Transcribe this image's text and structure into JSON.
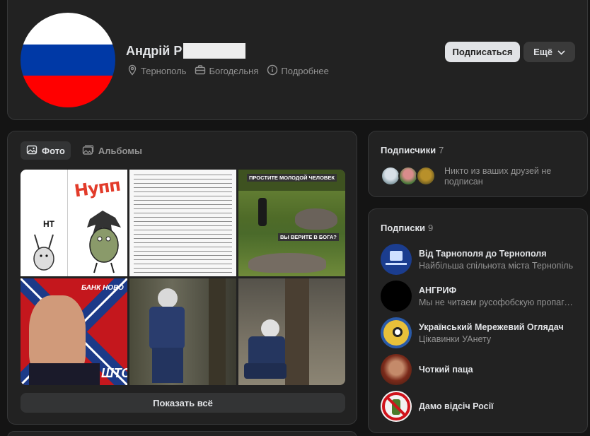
{
  "profile": {
    "name": "Андрій Р",
    "meta": [
      {
        "icon": "location-pin-icon",
        "label": "Тернополь"
      },
      {
        "icon": "briefcase-icon",
        "label": "Богодєльня"
      },
      {
        "icon": "info-icon",
        "label": "Подробнее"
      }
    ],
    "subscribe_label": "Подписаться",
    "more_label": "Ещё",
    "avatar_colors": [
      "#ffffff",
      "#0039a6",
      "#ff0000"
    ]
  },
  "photos": {
    "tabs": [
      {
        "label": "Фото",
        "icon": "photo-icon",
        "active": true
      },
      {
        "label": "Альбомы",
        "icon": "album-icon",
        "active": false
      }
    ],
    "items": [
      {
        "caption": "НТ",
        "caption2": "Нупп"
      },
      {
        "caption": ""
      },
      {
        "caption": "ПРОСТИТЕ МОЛОДОЙ ЧЕЛОВЕК",
        "caption2": "ВЫ ВЕРИТЕ В БОГА?"
      },
      {
        "caption": "БАНК НОВО",
        "caption2": "ШТО"
      },
      {
        "caption": ""
      },
      {
        "caption": ""
      }
    ],
    "show_all_label": "Показать всё"
  },
  "followers": {
    "title": "Подписчики",
    "count": "7",
    "text": "Никто из ваших друзей не подписан"
  },
  "subscriptions": {
    "title": "Подписки",
    "count": "9",
    "items": [
      {
        "name": "Від Тарнополя до Тернополя",
        "desc": "Найбільша спільнота міста Тернопіль",
        "color": "#1b3d8f"
      },
      {
        "name": "АНГРИФ",
        "desc": "Мы не читаем русофобскую пропаган...",
        "color": "#000000"
      },
      {
        "name": "Український Мережевий Оглядач",
        "desc": "Цікавинки УАнету",
        "color": "#d4b23a"
      },
      {
        "name": "Чоткий паца",
        "desc": "",
        "color": "#7a2a1a"
      },
      {
        "name": "Дамо відсіч Росії",
        "desc": "",
        "color": "#e6e6e6"
      }
    ]
  }
}
